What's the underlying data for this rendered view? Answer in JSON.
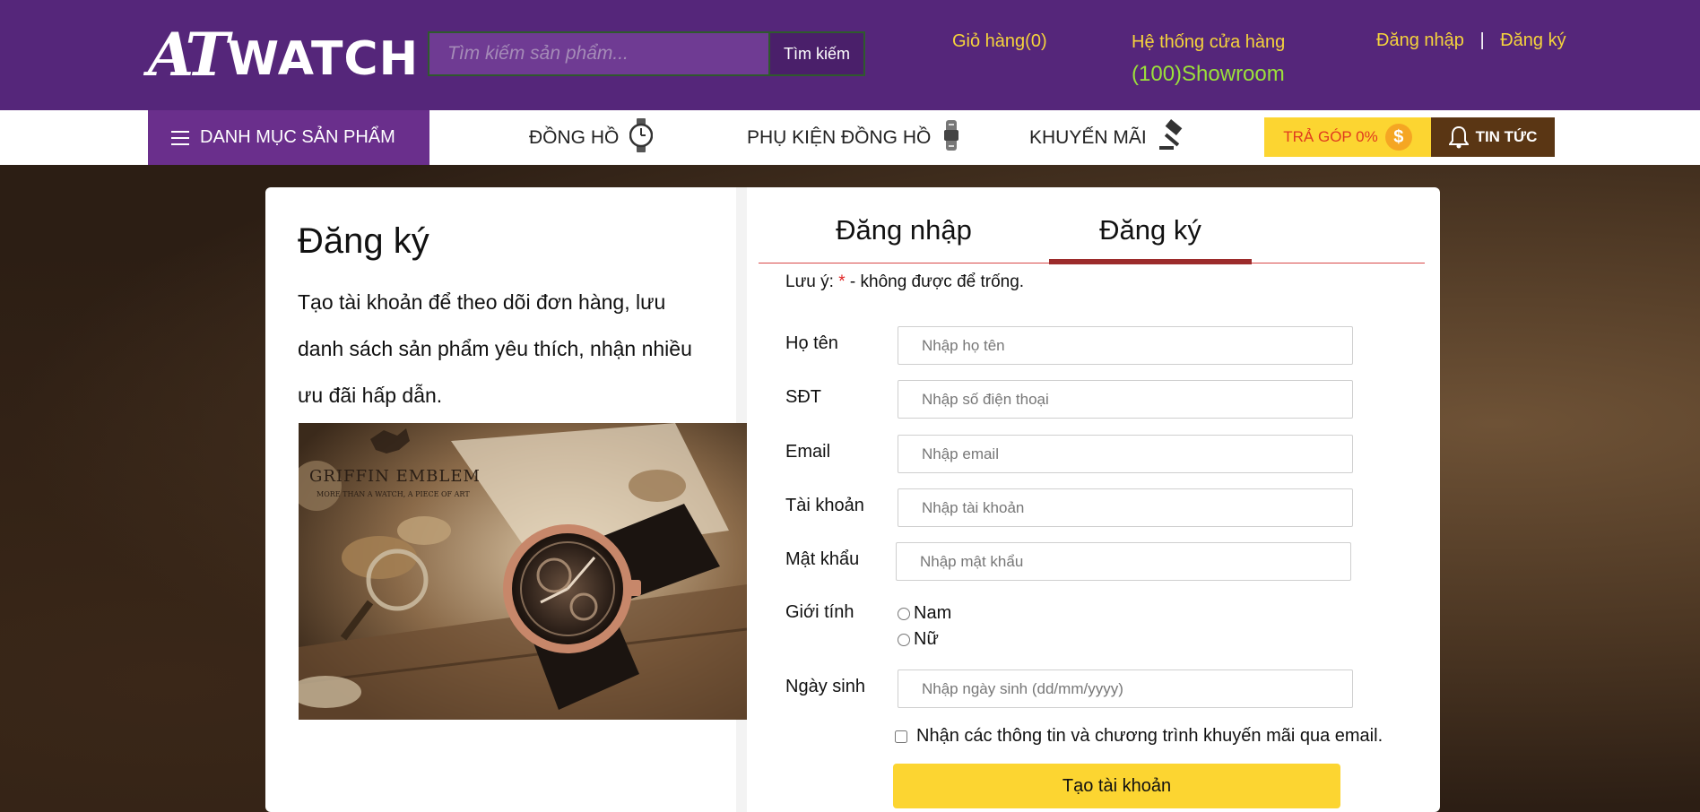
{
  "header": {
    "logo_mark": "AT",
    "logo_text": "WATCH",
    "search_placeholder": "Tìm kiếm sản phẩm...",
    "search_button": "Tìm kiếm",
    "cart": "Giỏ hàng(0)",
    "store_title": "Hệ thống cửa hàng",
    "store_count": "(100)Showroom",
    "login": "Đăng nhập",
    "separator": "|",
    "register": "Đăng ký"
  },
  "nav": {
    "categories": "DANH MỤC SẢN PHẨM",
    "items": [
      {
        "label": "ĐỒNG HỒ",
        "icon": "watch-icon"
      },
      {
        "label": "PHỤ KIỆN ĐỒNG HỒ",
        "icon": "watch-strap-icon"
      },
      {
        "label": "KHUYẾN MÃI",
        "icon": "gavel-icon"
      }
    ],
    "installment": "TRẢ GÓP 0%",
    "installment_icon": "$",
    "news": "TIN TỨC"
  },
  "intro": {
    "title": "Đăng ký",
    "description": "Tạo tài khoản để theo dõi đơn hàng, lưu danh sách sản phẩm yêu thích, nhận nhiều ưu đãi hấp dẫn.",
    "image_brand": "GRIFFIN EMBLEM",
    "image_tagline": "MORE THAN A WATCH, A PIECE OF ART"
  },
  "tabs": {
    "login": "Đăng nhập",
    "register": "Đăng ký",
    "active": "register"
  },
  "form": {
    "note_prefix": "Lưu ý:",
    "note_star": "*",
    "note_suffix": "- không được để trống.",
    "fields": {
      "fullname": {
        "label": "Họ tên",
        "placeholder": "Nhập họ tên"
      },
      "phone": {
        "label": "SĐT",
        "placeholder": "Nhập số điện thoại"
      },
      "email": {
        "label": "Email",
        "placeholder": "Nhập email"
      },
      "username": {
        "label": "Tài khoản",
        "placeholder": "Nhập tài khoản"
      },
      "password": {
        "label": "Mật khẩu",
        "placeholder": "Nhập mật khẩu"
      },
      "birthday": {
        "label": "Ngày sinh",
        "placeholder": "Nhập ngày sinh (dd/mm/yyyy)"
      }
    },
    "gender": {
      "label": "Giới tính",
      "options": [
        "Nam",
        "Nữ"
      ]
    },
    "newsletter": "Nhận các thông tin và chương trình khuyến mãi qua email.",
    "submit": "Tạo tài khoản"
  },
  "colors": {
    "header_bg": "#55267a",
    "accent_yellow": "#f5d33c",
    "showroom_green": "#9be03b",
    "category_bg": "#6a2f8c",
    "tab_active_underline": "#9c2b2b",
    "button_yellow": "#fcd531"
  }
}
